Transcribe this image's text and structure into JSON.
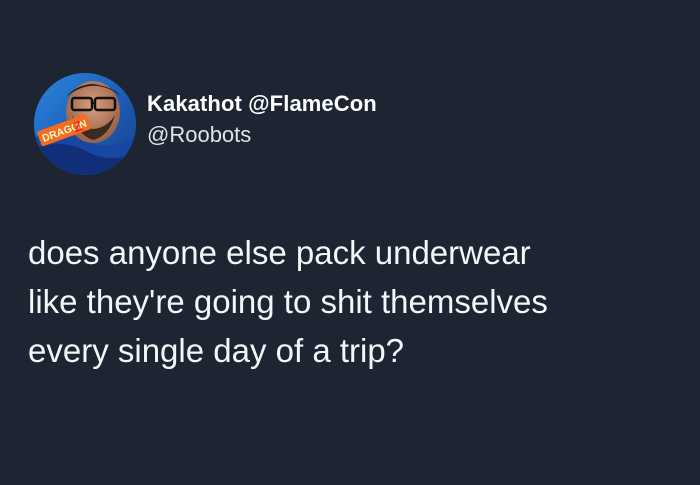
{
  "tweet": {
    "display_name": "Kakathot @FlameCon",
    "handle": "@Roobots",
    "avatar_text": "DRAGON BALL Z",
    "text": "does anyone else pack underwear\nlike they're going to shit themselves\nevery single day of a trip?"
  },
  "colors": {
    "background": "#1d2533",
    "text": "#f4f6f9",
    "avatar_accent": "#1f66c6"
  }
}
